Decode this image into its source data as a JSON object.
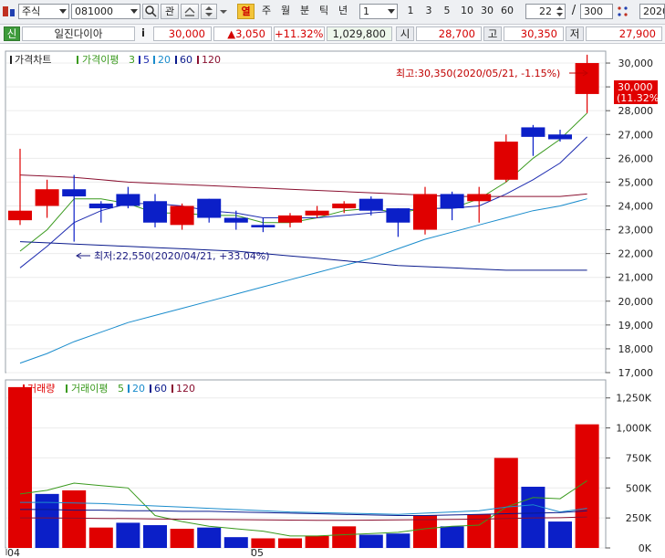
{
  "toolbar": {
    "market_select": "주식",
    "code_input": "081000",
    "btn_gwan": "관",
    "btn_yeol": "열",
    "periods": [
      "주",
      "월",
      "분",
      "틱",
      "년"
    ],
    "interval_value": "1",
    "quick_intervals": [
      "1",
      "3",
      "5",
      "10",
      "30",
      "60"
    ],
    "count_value": "22",
    "slash": "/",
    "total_value": "300",
    "date_value": "2020"
  },
  "info": {
    "badge": "신",
    "stock_name": "일진다이아",
    "info_btn": "i",
    "price": "30,000",
    "change": "▲3,050",
    "change_pct": "+11.32%",
    "volume": "1,029,800",
    "open_label": "시",
    "open": "28,700",
    "high_label": "고",
    "high": "30,350",
    "low_label": "저",
    "low": "27,900"
  },
  "price_panel": {
    "legend_title": "가격차트",
    "legend_ma": "가격이평",
    "legend_periods": [
      "3",
      "5",
      "20",
      "60",
      "120"
    ],
    "high_note": "최고:30,350(2020/05/21, -1.15%)",
    "low_note": "최저:22,550(2020/04/21, +33.04%)",
    "tag_price": "30,000",
    "tag_pct": "(11.32%)"
  },
  "volume_panel": {
    "legend_title": "거래량",
    "legend_ma": "거래이평",
    "legend_periods": [
      "5",
      "20",
      "60",
      "120"
    ]
  },
  "colors": {
    "up": "#e00000",
    "down": "#0b1fc8",
    "ma3": "#3a9a1e",
    "ma5": "#1d2bb0",
    "ma20": "#1a8ccc",
    "ma60": "#0a1a8c",
    "ma120": "#8a1030"
  },
  "chart_data": [
    {
      "type": "candlestick",
      "title": "가격차트",
      "x_labels": [
        "04",
        "05"
      ],
      "ylim": [
        17000,
        30500
      ],
      "y_ticks": [
        "30,000",
        "29,000",
        "28,000",
        "27,000",
        "26,000",
        "25,000",
        "24,000",
        "23,000",
        "22,000",
        "21,000",
        "20,000",
        "19,000",
        "18,000",
        "17,000"
      ],
      "candles": [
        {
          "o": 23400,
          "h": 26400,
          "l": 23200,
          "c": 23800
        },
        {
          "o": 24000,
          "h": 25100,
          "l": 23500,
          "c": 24700
        },
        {
          "o": 24700,
          "h": 25300,
          "l": 22500,
          "c": 24400
        },
        {
          "o": 24100,
          "h": 24200,
          "l": 23300,
          "c": 23900
        },
        {
          "o": 24500,
          "h": 24800,
          "l": 23900,
          "c": 24000
        },
        {
          "o": 24200,
          "h": 24500,
          "l": 23100,
          "c": 23300
        },
        {
          "o": 23200,
          "h": 24100,
          "l": 23000,
          "c": 24000
        },
        {
          "o": 24300,
          "h": 24300,
          "l": 23300,
          "c": 23500
        },
        {
          "o": 23500,
          "h": 23800,
          "l": 23000,
          "c": 23300
        },
        {
          "o": 23200,
          "h": 23500,
          "l": 22900,
          "c": 23100
        },
        {
          "o": 23300,
          "h": 23700,
          "l": 23100,
          "c": 23600
        },
        {
          "o": 23600,
          "h": 24000,
          "l": 23500,
          "c": 23800
        },
        {
          "o": 23900,
          "h": 24200,
          "l": 23700,
          "c": 24100
        },
        {
          "o": 24300,
          "h": 24400,
          "l": 23600,
          "c": 23800
        },
        {
          "o": 23900,
          "h": 23900,
          "l": 22700,
          "c": 23300
        },
        {
          "o": 23000,
          "h": 24800,
          "l": 22800,
          "c": 24500
        },
        {
          "o": 24500,
          "h": 24600,
          "l": 23400,
          "c": 23900
        },
        {
          "o": 24200,
          "h": 24800,
          "l": 23300,
          "c": 24500
        },
        {
          "o": 25100,
          "h": 27000,
          "l": 25000,
          "c": 26700
        },
        {
          "o": 27300,
          "h": 27400,
          "l": 26100,
          "c": 26900
        },
        {
          "o": 27000,
          "h": 27200,
          "l": 26700,
          "c": 26800
        },
        {
          "o": 28700,
          "h": 30350,
          "l": 27900,
          "c": 30000
        }
      ],
      "series": [
        {
          "name": "3",
          "values": [
            22100,
            23000,
            24300,
            24300,
            24100,
            23700,
            23700,
            23600,
            23600,
            23300,
            23300,
            23500,
            23800,
            23900,
            23700,
            23900,
            23900,
            24300,
            25000,
            26000,
            26800,
            27900
          ]
        },
        {
          "name": "5",
          "values": [
            21400,
            22300,
            23300,
            23800,
            24100,
            24100,
            24000,
            23800,
            23700,
            23500,
            23500,
            23500,
            23600,
            23700,
            23800,
            23900,
            23900,
            24000,
            24500,
            25100,
            25800,
            26900
          ]
        },
        {
          "name": "20",
          "values": [
            17400,
            17800,
            18300,
            18700,
            19100,
            19400,
            19700,
            20000,
            20300,
            20600,
            20900,
            21200,
            21500,
            21800,
            22200,
            22600,
            22900,
            23200,
            23500,
            23800,
            24000,
            24300
          ]
        },
        {
          "name": "60",
          "values": [
            22500,
            22450,
            22400,
            22350,
            22300,
            22250,
            22200,
            22150,
            22100,
            22000,
            21900,
            21800,
            21700,
            21600,
            21500,
            21450,
            21400,
            21350,
            21300,
            21300,
            21300,
            21300
          ]
        },
        {
          "name": "120",
          "values": [
            25300,
            25250,
            25200,
            25100,
            25000,
            24950,
            24900,
            24850,
            24800,
            24750,
            24700,
            24650,
            24600,
            24550,
            24500,
            24450,
            24400,
            24400,
            24400,
            24400,
            24400,
            24500
          ]
        }
      ]
    },
    {
      "type": "bar",
      "title": "거래량",
      "x_labels": [
        "04",
        "05"
      ],
      "ylim": [
        0,
        1400000
      ],
      "y_ticks": [
        "1,250K",
        "1,000K",
        "750K",
        "500K",
        "250K",
        "0K"
      ],
      "values": [
        1340000,
        450000,
        480000,
        170000,
        210000,
        190000,
        160000,
        170000,
        90000,
        80000,
        80000,
        100000,
        180000,
        110000,
        120000,
        270000,
        180000,
        280000,
        750000,
        510000,
        220000,
        1030000
      ],
      "up": [
        true,
        false,
        true,
        true,
        false,
        false,
        true,
        false,
        false,
        true,
        true,
        true,
        true,
        false,
        false,
        true,
        false,
        true,
        true,
        false,
        false,
        true
      ],
      "series": [
        {
          "name": "5",
          "values": [
            450000,
            480000,
            540000,
            520000,
            500000,
            270000,
            220000,
            180000,
            160000,
            140000,
            100000,
            100000,
            110000,
            120000,
            130000,
            160000,
            180000,
            190000,
            340000,
            420000,
            410000,
            560000
          ]
        },
        {
          "name": "20",
          "values": [
            380000,
            380000,
            375000,
            370000,
            360000,
            350000,
            340000,
            330000,
            320000,
            310000,
            300000,
            295000,
            290000,
            285000,
            280000,
            290000,
            300000,
            310000,
            340000,
            360000,
            300000,
            330000
          ]
        },
        {
          "name": "60",
          "values": [
            320000,
            320000,
            315000,
            315000,
            310000,
            310000,
            305000,
            305000,
            300000,
            295000,
            290000,
            285000,
            280000,
            275000,
            270000,
            270000,
            275000,
            280000,
            285000,
            290000,
            295000,
            310000
          ]
        },
        {
          "name": "120",
          "values": [
            250000,
            250000,
            248000,
            246000,
            244000,
            242000,
            240000,
            238000,
            236000,
            234000,
            232000,
            230000,
            230000,
            232000,
            234000,
            236000,
            238000,
            240000,
            245000,
            250000,
            252000,
            258000
          ]
        }
      ]
    }
  ]
}
